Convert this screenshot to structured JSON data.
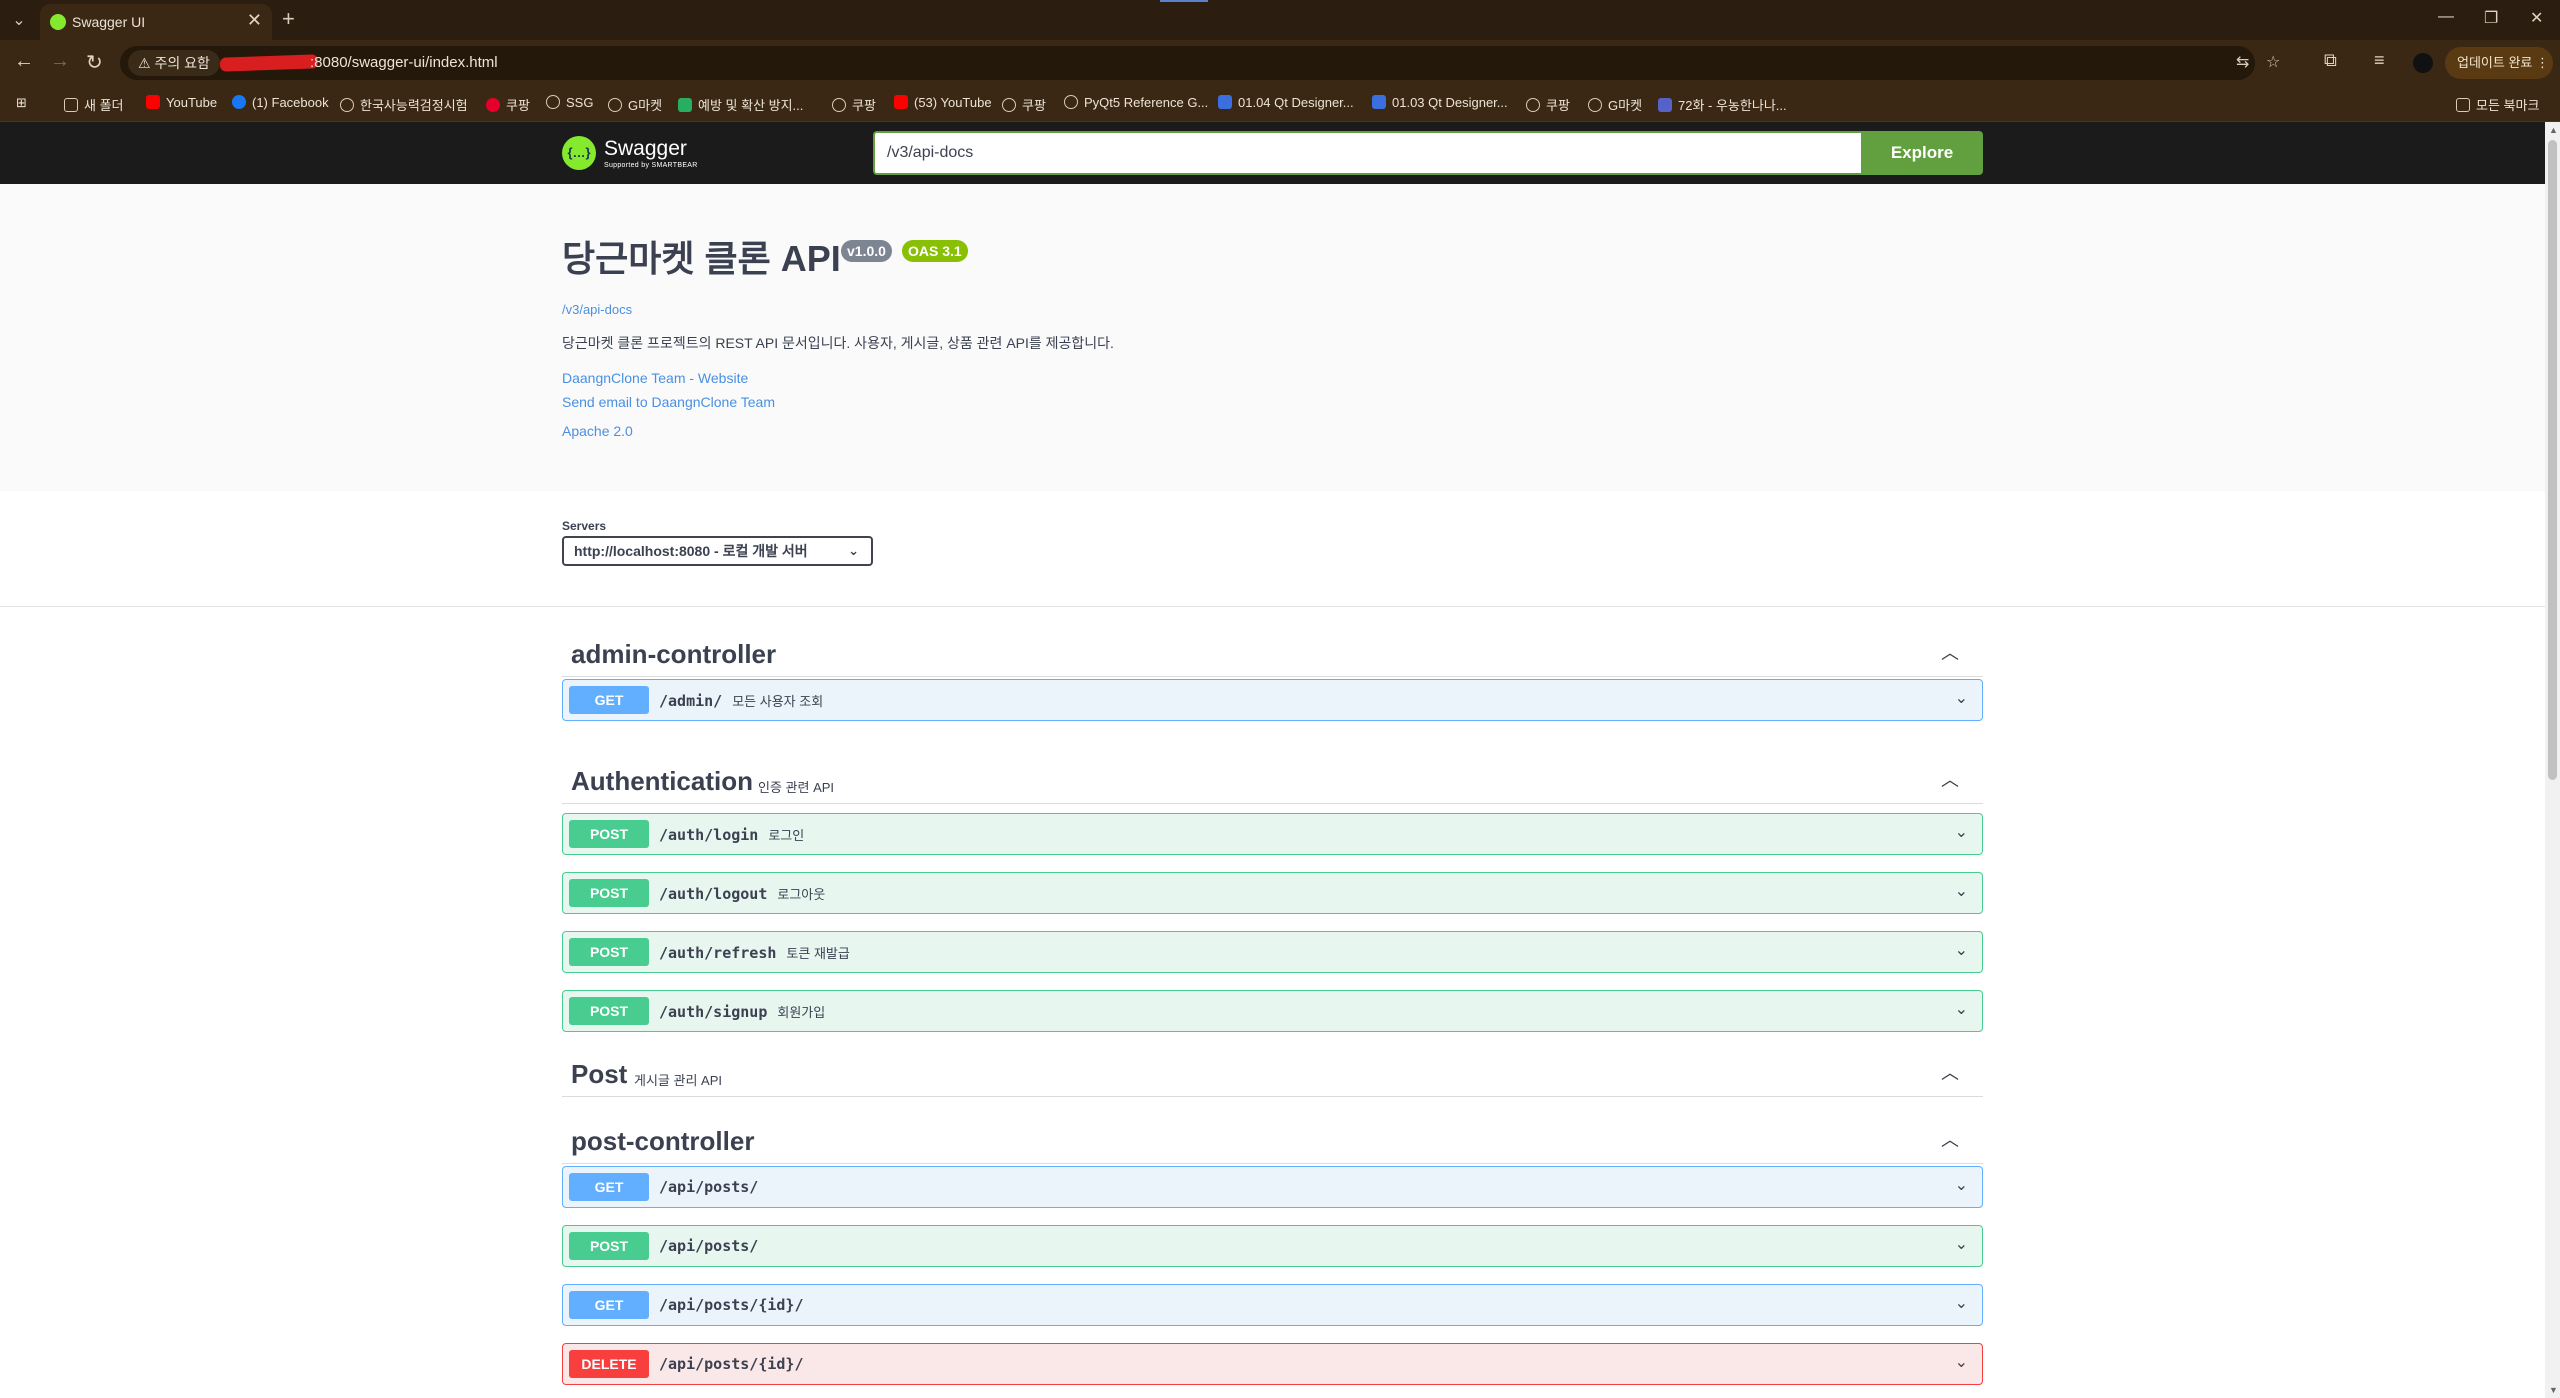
{
  "browser": {
    "tab_title": "Swagger UI",
    "tab_close": "✕",
    "new_tab": "+",
    "security_chip": "⚠ 주의 요함",
    "url": ":8080/swagger-ui/index.html",
    "update_label": "업데이트 완료",
    "minimize": "—",
    "restore": "❐",
    "close": "✕"
  },
  "bookmarks": {
    "items": [
      {
        "label": "새 폴더",
        "color": "#d8cbb7"
      },
      {
        "label": "YouTube",
        "color": "#ff0000"
      },
      {
        "label": "(1) Facebook",
        "color": "#1877f2"
      },
      {
        "label": "한국사능력검정시험",
        "color": "#d8cbb7"
      },
      {
        "label": "쿠팡",
        "color": "#e4002b"
      },
      {
        "label": "SSG",
        "color": "#d8cbb7"
      },
      {
        "label": "G마켓",
        "color": "#d8cbb7"
      },
      {
        "label": "예방 및 확산 방지...",
        "color": "#27ae60"
      },
      {
        "label": "쿠팡",
        "color": "#d8cbb7"
      },
      {
        "label": "(53) YouTube",
        "color": "#ff0000"
      },
      {
        "label": "쿠팡",
        "color": "#d8cbb7"
      },
      {
        "label": "PyQt5 Reference G...",
        "color": "#d8cbb7"
      },
      {
        "label": "01.04 Qt Designer...",
        "color": "#3b6fe0"
      },
      {
        "label": "01.03 Qt Designer...",
        "color": "#3b6fe0"
      },
      {
        "label": "쿠팡",
        "color": "#d8cbb7"
      },
      {
        "label": "G마켓",
        "color": "#d8cbb7"
      },
      {
        "label": "72화 - 우농한나나...",
        "color": "#5563c9"
      }
    ],
    "all_bookmarks": "모든 북마크"
  },
  "swagger": {
    "logo_text": "Swagger",
    "logo_sub": "Supported by SMARTBEAR",
    "spec_url": "/v3/api-docs",
    "explore_label": "Explore",
    "colors": {
      "topbar": "#1b1b1b",
      "accent": "#62a03f",
      "get": "#61affe",
      "post": "#49cc90",
      "delete": "#f93e3e"
    }
  },
  "info": {
    "title": "당근마켓 클론 API",
    "version": "v1.0.0",
    "oas": "OAS 3.1",
    "doc_url": "/v3/api-docs",
    "description": "당근마켓 클론 프로젝트의 REST API 문서입니다. 사용자, 게시글, 상품 관련 API를 제공합니다.",
    "link_website": "DaangnClone Team - Website",
    "link_email": "Send email to DaangnClone Team",
    "link_license": "Apache 2.0"
  },
  "servers": {
    "label": "Servers",
    "selected": "http://localhost:8080 - 로컬 개발 서버"
  },
  "tags": {
    "admin": {
      "name": "admin-controller",
      "desc": ""
    },
    "auth": {
      "name": "Authentication",
      "desc": "인증 관련 API"
    },
    "post": {
      "name": "Post",
      "desc": "게시글 관리 API"
    },
    "postctl": {
      "name": "post-controller",
      "desc": ""
    }
  },
  "operations": [
    {
      "method": "GET",
      "path": "/admin/",
      "summary": "모든 사용자 조회"
    },
    {
      "method": "POST",
      "path": "/auth/login",
      "summary": "로그인"
    },
    {
      "method": "POST",
      "path": "/auth/logout",
      "summary": "로그아웃"
    },
    {
      "method": "POST",
      "path": "/auth/refresh",
      "summary": "토큰 재발급"
    },
    {
      "method": "POST",
      "path": "/auth/signup",
      "summary": "회원가입"
    },
    {
      "method": "GET",
      "path": "/api/posts/",
      "summary": ""
    },
    {
      "method": "POST",
      "path": "/api/posts/",
      "summary": ""
    },
    {
      "method": "GET",
      "path": "/api/posts/{id}/",
      "summary": ""
    },
    {
      "method": "DELETE",
      "path": "/api/posts/{id}/",
      "summary": ""
    }
  ]
}
